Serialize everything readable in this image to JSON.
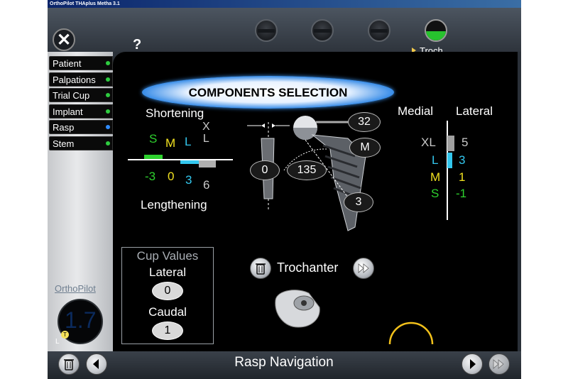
{
  "window": {
    "title": "OrthoPilot THAplus Metha 3.1"
  },
  "header": {
    "close_icon": "close-icon",
    "help_label": "?",
    "current_step_label": "Troch.",
    "step_count": 4,
    "active_step": 4
  },
  "sidebar": {
    "items": [
      {
        "label": "Patient",
        "status_color": "#2ecc40"
      },
      {
        "label": "Palpations",
        "status_color": "#2ecc40"
      },
      {
        "label": "Trial Cup",
        "status_color": "#2ecc40"
      },
      {
        "label": "Implant",
        "status_color": "#2ecc40"
      },
      {
        "label": "Rasp",
        "status_color": "#2f8cff"
      },
      {
        "label": "Stem",
        "status_color": "#2ecc40"
      }
    ],
    "logo_text": "OrthoPilot",
    "gauge_value": "1.7",
    "gauge_marker": "T",
    "gauge_side": "L"
  },
  "main": {
    "title": "COMPONENTS SELECTION",
    "shortening_label": "Shortening",
    "lengthening_label": "Lengthening",
    "sizes": [
      {
        "label": "S",
        "value": "-3",
        "color": "#2ed12e"
      },
      {
        "label": "M",
        "value": "0",
        "color": "#f0e020"
      },
      {
        "label": "L",
        "value": "3",
        "color": "#33c7ee"
      },
      {
        "label": "X\nL",
        "value": "6",
        "color": "#c8c8c8"
      }
    ],
    "medial_label": "Medial",
    "lateral_label": "Lateral",
    "lateral_scale": [
      {
        "size": "XL",
        "value": "5",
        "color": "#c8c8c8"
      },
      {
        "size": "L",
        "value": "3",
        "color": "#33c7ee"
      },
      {
        "size": "M",
        "value": "1",
        "color": "#f0e020"
      },
      {
        "size": "S",
        "value": "-1",
        "color": "#2ed12e"
      }
    ],
    "implant": {
      "head_size": "32",
      "neck_size": "M",
      "angle_left": "0",
      "ccd_angle": "135",
      "offset": "3"
    },
    "cup_values": {
      "title": "Cup Values",
      "lateral_label": "Lateral",
      "lateral_value": "0",
      "caudal_label": "Caudal",
      "caudal_value": "1"
    },
    "trochanter_label": "Trochanter"
  },
  "footer": {
    "title": "Rasp Navigation"
  },
  "colors": {
    "accent_green": "#27c22e",
    "accent_blue": "#3a8fe8",
    "background": "#000000"
  }
}
